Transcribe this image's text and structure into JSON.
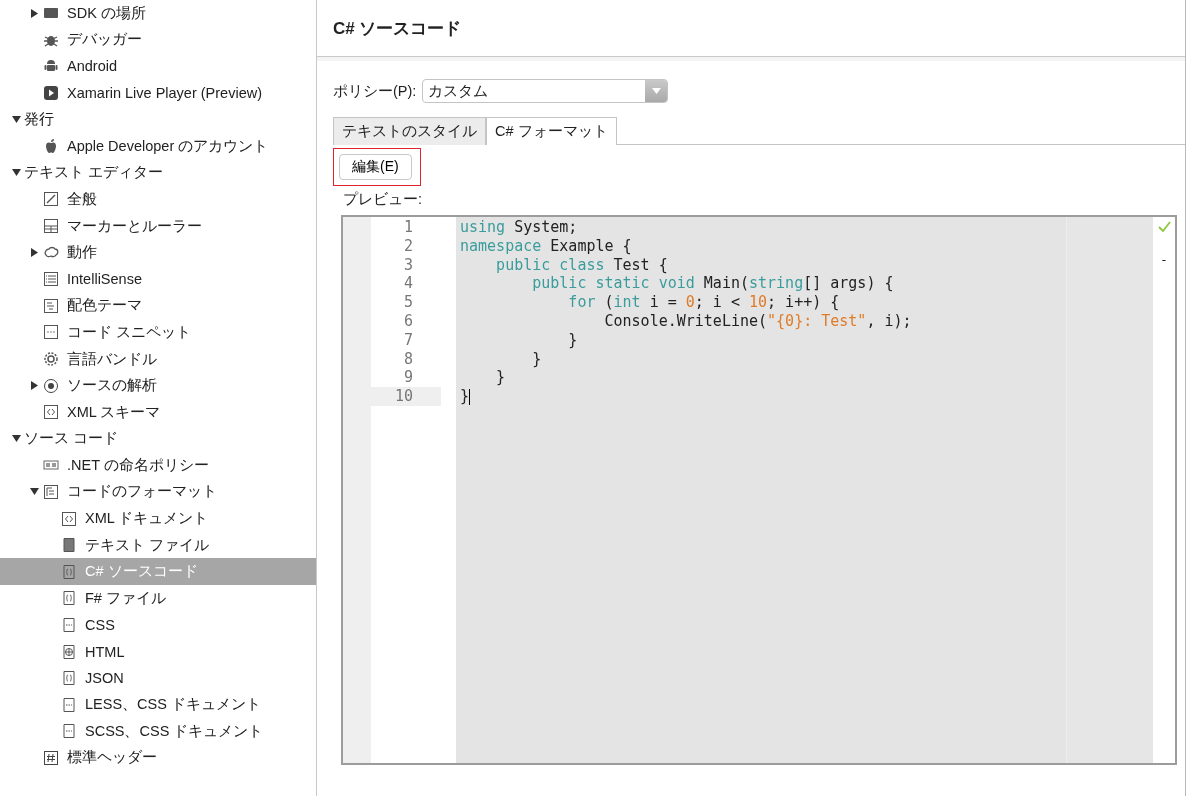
{
  "sidebar": {
    "continued_items": [
      {
        "label": "SDK の場所",
        "expanded": false,
        "selected": false
      },
      {
        "label": "デバッガー",
        "selected": false
      },
      {
        "label": "Android",
        "selected": false
      },
      {
        "label": "Xamarin Live Player (Preview)",
        "selected": false
      }
    ],
    "items": [
      {
        "label": "発行",
        "expanded": true,
        "selected": false,
        "children": [
          {
            "label": "Apple Developer のアカウント",
            "selected": false
          }
        ]
      },
      {
        "label": "テキスト エディター",
        "expanded": true,
        "selected": false,
        "children": [
          {
            "label": "全般",
            "selected": false
          },
          {
            "label": "マーカーとルーラー",
            "selected": false
          },
          {
            "label": "動作",
            "expanded": false,
            "selected": false
          },
          {
            "label": "IntelliSense",
            "selected": false
          },
          {
            "label": "配色テーマ",
            "selected": false
          },
          {
            "label": "コード スニペット",
            "selected": false
          },
          {
            "label": "言語バンドル",
            "selected": false
          },
          {
            "label": "ソースの解析",
            "expanded": false,
            "selected": false
          },
          {
            "label": "XML スキーマ",
            "selected": false
          }
        ]
      },
      {
        "label": "ソース コード",
        "expanded": true,
        "selected": false,
        "children": [
          {
            "label": ".NET の命名ポリシー",
            "selected": false
          },
          {
            "label": "コードのフォーマット",
            "expanded": true,
            "selected": false,
            "children": [
              {
                "label": "XML ドキュメント",
                "selected": false
              },
              {
                "label": "テキスト ファイル",
                "selected": false
              },
              {
                "label": "C# ソースコード",
                "selected": true
              },
              {
                "label": "F# ファイル",
                "selected": false
              },
              {
                "label": "CSS",
                "selected": false
              },
              {
                "label": "HTML",
                "selected": false
              },
              {
                "label": "JSON",
                "selected": false
              },
              {
                "label": "LESS、CSS ドキュメント",
                "selected": false
              },
              {
                "label": "SCSS、CSS ドキュメント",
                "selected": false
              }
            ]
          },
          {
            "label": "標準ヘッダー",
            "selected": false
          }
        ]
      }
    ]
  },
  "panel": {
    "title": "C# ソースコード",
    "policy": {
      "label": "ポリシー(P):",
      "value": "カスタム"
    },
    "tabs": [
      {
        "label": "テキストのスタイル",
        "selected": false
      },
      {
        "label": "C# フォーマット",
        "selected": true
      }
    ],
    "edit_button": {
      "label": "編集(E)",
      "highlighted": true
    },
    "preview_label": "プレビュー:",
    "editor": {
      "ruler_mark": "-",
      "lines": [
        {
          "number": "1",
          "current": false,
          "tokens": [
            {
              "text": "using",
              "kind": "keyword"
            },
            {
              "text": " System;",
              "kind": "plain"
            }
          ]
        },
        {
          "number": "2",
          "current": false,
          "tokens": [
            {
              "text": "namespace",
              "kind": "keyword"
            },
            {
              "text": " Example {",
              "kind": "plain"
            }
          ]
        },
        {
          "number": "3",
          "current": false,
          "tokens": [
            {
              "text": "    public class",
              "kind": "keyword"
            },
            {
              "text": " Test {",
              "kind": "plain"
            }
          ]
        },
        {
          "number": "4",
          "current": false,
          "tokens": [
            {
              "text": "        public static void",
              "kind": "keyword"
            },
            {
              "text": " Main(",
              "kind": "plain"
            },
            {
              "text": "string",
              "kind": "keyword"
            },
            {
              "text": "[] args) {",
              "kind": "plain"
            }
          ]
        },
        {
          "number": "5",
          "current": false,
          "tokens": [
            {
              "text": "            for",
              "kind": "keyword"
            },
            {
              "text": " (",
              "kind": "plain"
            },
            {
              "text": "int",
              "kind": "keyword"
            },
            {
              "text": " i = ",
              "kind": "plain"
            },
            {
              "text": "0",
              "kind": "number"
            },
            {
              "text": "; i < ",
              "kind": "plain"
            },
            {
              "text": "10",
              "kind": "number"
            },
            {
              "text": "; i++) {",
              "kind": "plain"
            }
          ]
        },
        {
          "number": "6",
          "current": false,
          "tokens": [
            {
              "text": "                Console.WriteLine(",
              "kind": "plain"
            },
            {
              "text": "\"{0}: Test\"",
              "kind": "string"
            },
            {
              "text": ", i);",
              "kind": "plain"
            }
          ]
        },
        {
          "number": "7",
          "current": false,
          "tokens": [
            {
              "text": "            }",
              "kind": "plain"
            }
          ]
        },
        {
          "number": "8",
          "current": false,
          "tokens": [
            {
              "text": "        }",
              "kind": "plain"
            }
          ]
        },
        {
          "number": "9",
          "current": false,
          "tokens": [
            {
              "text": "    }",
              "kind": "plain"
            }
          ]
        },
        {
          "number": "10",
          "current": true,
          "tokens": [
            {
              "text": "}",
              "kind": "plain"
            }
          ]
        }
      ]
    }
  }
}
